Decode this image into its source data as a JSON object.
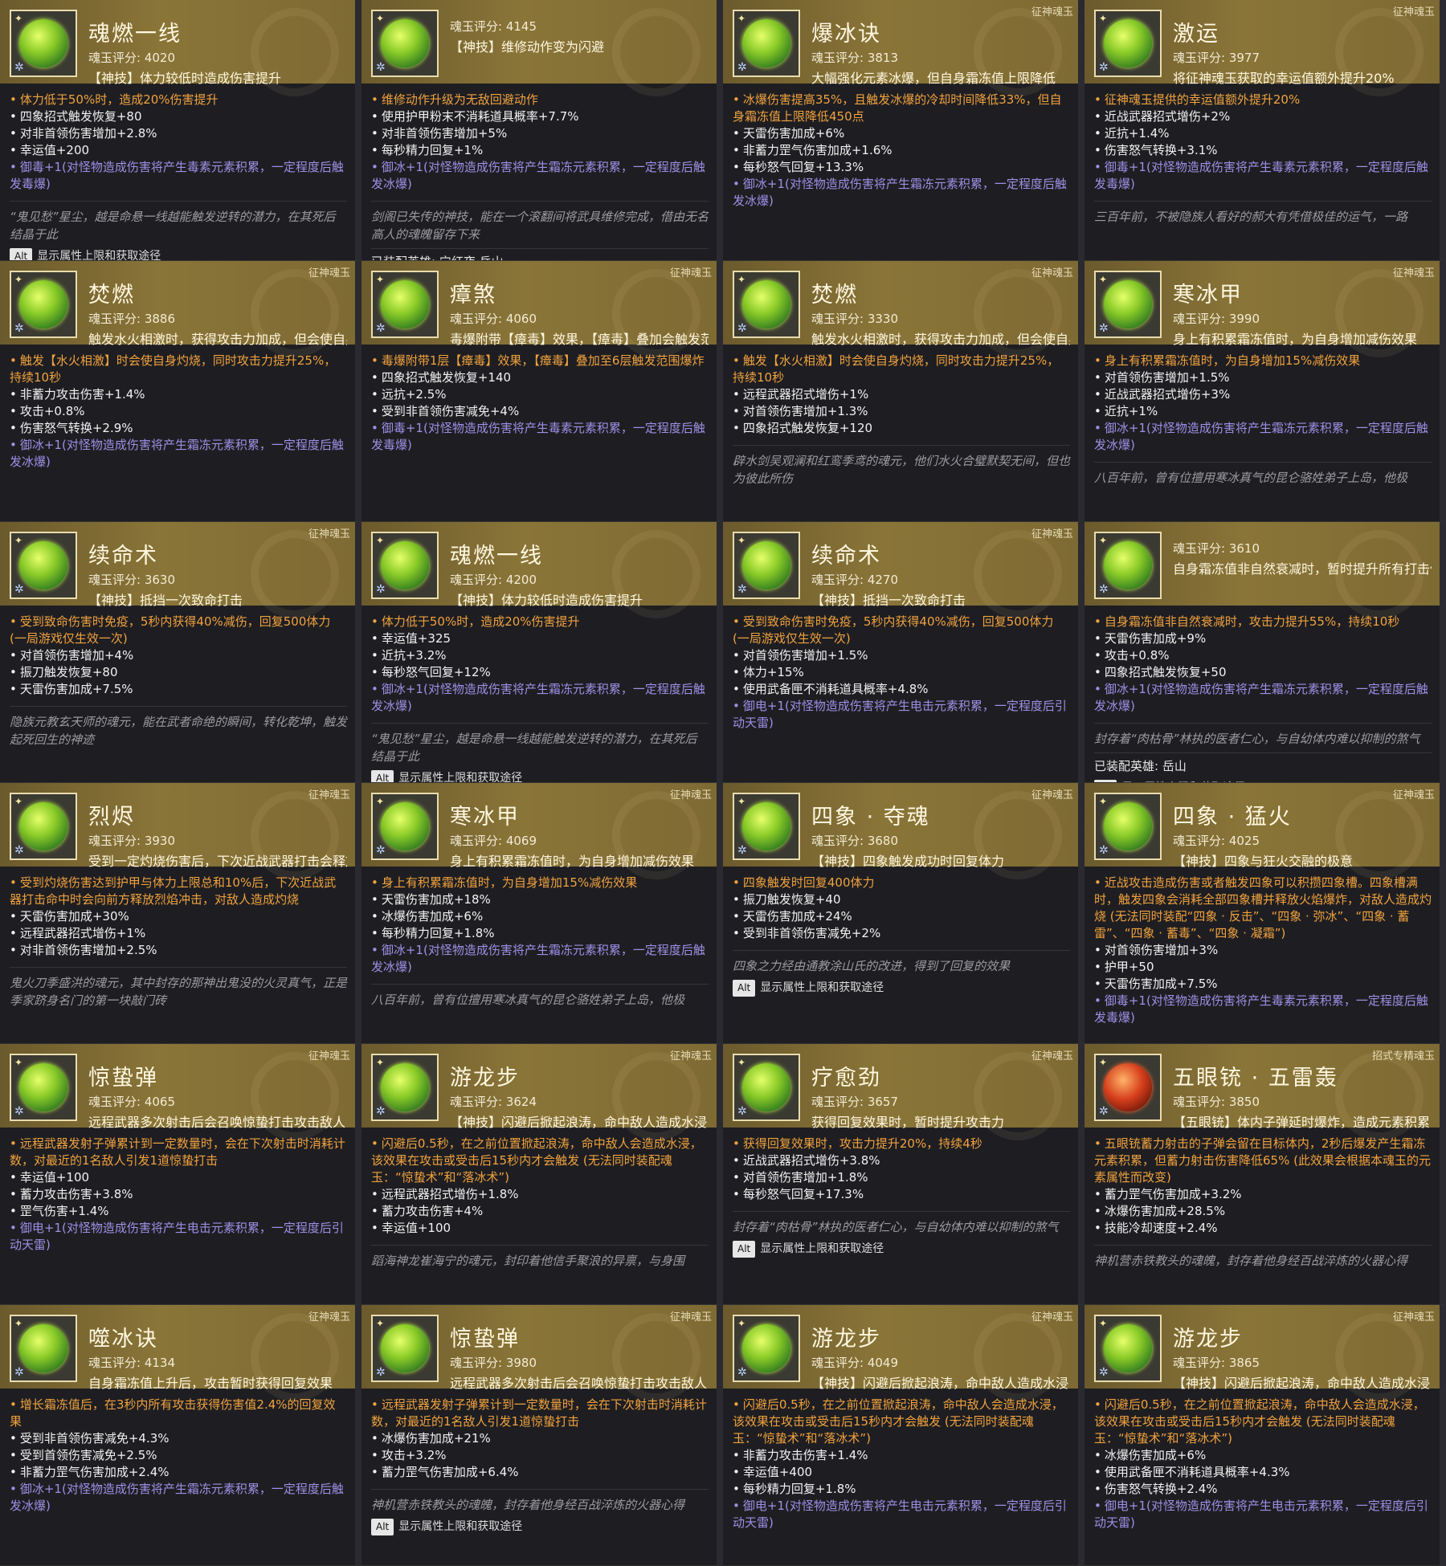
{
  "alt_key": "Alt",
  "alt_text": "显示属性上限和获取途径",
  "cards": [
    {
      "name": "魂燃一线",
      "type": "",
      "score": "魂玉评分: 4020",
      "desc": "【神技】体力较低时造成伤害提升",
      "glyph": "green-flame",
      "lines": [
        {
          "c": "orange",
          "t": "体力低于50%时，造成20%伤害提升"
        },
        {
          "c": "white",
          "t": "四象招式触发恢复+80"
        },
        {
          "c": "white",
          "t": "对非首领伤害增加+2.8%"
        },
        {
          "c": "white",
          "t": "幸运值+200"
        },
        {
          "c": "purple",
          "t": "御毒+1(对怪物造成伤害将产生毒素元素积累，一定程度后触发毒爆)"
        }
      ],
      "flavor": "“鬼见愁”星尘，越是命悬一线越能触发逆转的潜力，在其死后结晶于此",
      "equipped": "",
      "alt": true
    },
    {
      "name": "",
      "type": "",
      "score": "魂玉评分: 4145",
      "desc": "【神技】维修动作变为闪避",
      "glyph": "green-flame",
      "lines": [
        {
          "c": "orange",
          "t": "维修动作升级为无敌回避动作"
        },
        {
          "c": "white",
          "t": "使用护甲粉末不消耗道具概率+7.7%"
        },
        {
          "c": "white",
          "t": "对非首领伤害增加+5%"
        },
        {
          "c": "white",
          "t": "每秒精力回复+1%"
        },
        {
          "c": "purple",
          "t": "御冰+1(对怪物造成伤害将产生霜冻元素积累，一定程度后触发冰爆)"
        }
      ],
      "flavor": "剑阁已失传的神技，能在一个滚翻间将武具维修完成，借由无名高人的魂魄留存下来",
      "equipped": "已装配英雄: 宁红夜 岳山",
      "alt": true
    },
    {
      "name": "爆冰诀",
      "type": "征神魂玉",
      "score": "魂玉评分: 3813",
      "desc": "大幅强化元素冰爆，但自身霜冻值上限降低",
      "glyph": "green-flame",
      "lines": [
        {
          "c": "orange",
          "t": "冰爆伤害提高35%，且触发冰爆的冷却时间降低33%，但自身霜冻值上限降低450点"
        },
        {
          "c": "white",
          "t": "天雷伤害加成+6%"
        },
        {
          "c": "white",
          "t": "非蓄力罡气伤害加成+1.6%"
        },
        {
          "c": "white",
          "t": "每秒怒气回复+13.3%"
        },
        {
          "c": "purple",
          "t": "御冰+1(对怪物造成伤害将产生霜冻元素积累，一定程度后触发冰爆)"
        }
      ],
      "flavor": "",
      "equipped": "",
      "alt": false
    },
    {
      "name": "激运",
      "type": "征神魂玉",
      "score": "魂玉评分: 3977",
      "desc": "将征神魂玉获取的幸运值额外提升20%",
      "glyph": "green-flame",
      "lines": [
        {
          "c": "orange",
          "t": "征神魂玉提供的幸运值额外提升20%"
        },
        {
          "c": "white",
          "t": "近战武器招式增伤+2%"
        },
        {
          "c": "white",
          "t": "近抗+1.4%"
        },
        {
          "c": "white",
          "t": "伤害怒气转换+3.1%"
        },
        {
          "c": "purple",
          "t": "御毒+1(对怪物造成伤害将产生毒素元素积累，一定程度后触发毒爆)"
        }
      ],
      "flavor": "三百年前，不被隐族人看好的郝大有凭借极佳的运气，一路",
      "equipped": "",
      "alt": false
    },
    {
      "name": "焚燃",
      "type": "征神魂玉",
      "score": "魂玉评分: 3886",
      "desc": "触发水火相激时，获得攻击力加成，但会使自身灼烧",
      "glyph": "green-flame",
      "lines": [
        {
          "c": "orange",
          "t": "触发【水火相激】时会使自身灼烧，同时攻击力提升25%，持续10秒"
        },
        {
          "c": "white",
          "t": "非蓄力攻击伤害+1.4%"
        },
        {
          "c": "white",
          "t": "攻击+0.8%"
        },
        {
          "c": "white",
          "t": "伤害怒气转换+2.9%"
        },
        {
          "c": "purple",
          "t": "御冰+1(对怪物造成伤害将产生霜冻元素积累，一定程度后触发冰爆)"
        }
      ],
      "flavor": "",
      "equipped": "",
      "alt": false
    },
    {
      "name": "瘴煞",
      "type": "征神魂玉",
      "score": "魂玉评分: 4060",
      "desc": "毒爆附带【瘴毒】效果，【瘴毒】叠加会触发范围",
      "glyph": "green-flame",
      "lines": [
        {
          "c": "orange",
          "t": "毒爆附带1层【瘴毒】效果，【瘴毒】叠加至6层触发范围爆炸"
        },
        {
          "c": "white",
          "t": "四象招式触发恢复+140"
        },
        {
          "c": "white",
          "t": "远抗+2.5%"
        },
        {
          "c": "white",
          "t": "受到非首领伤害减免+4%"
        },
        {
          "c": "purple",
          "t": "御毒+1(对怪物造成伤害将产生毒素元素积累，一定程度后触发毒爆)"
        }
      ],
      "flavor": "",
      "equipped": "",
      "alt": false
    },
    {
      "name": "焚燃",
      "type": "征神魂玉",
      "score": "魂玉评分: 3330",
      "desc": "触发水火相激时，获得攻击力加成，但会使自身灼烧",
      "glyph": "green-flame",
      "lines": [
        {
          "c": "orange",
          "t": "触发【水火相激】时会使自身灼烧，同时攻击力提升25%，持续10秒"
        },
        {
          "c": "white",
          "t": "远程武器招式增伤+1%"
        },
        {
          "c": "white",
          "t": "对首领伤害增加+1.3%"
        },
        {
          "c": "white",
          "t": "四象招式触发恢复+120"
        }
      ],
      "flavor": "辟水剑吴观澜和红鸾季鸢的魂元，他们水火合璧默契无间，但也为彼此所伤",
      "equipped": "",
      "alt": false
    },
    {
      "name": "寒冰甲",
      "type": "征神魂玉",
      "score": "魂玉评分: 3990",
      "desc": "身上有积累霜冻值时，为自身增加减伤效果",
      "glyph": "green-flame",
      "lines": [
        {
          "c": "orange",
          "t": "身上有积累霜冻值时，为自身增加15%减伤效果"
        },
        {
          "c": "white",
          "t": "对首领伤害增加+1.5%"
        },
        {
          "c": "white",
          "t": "近战武器招式增伤+3%"
        },
        {
          "c": "white",
          "t": "近抗+1%"
        },
        {
          "c": "purple",
          "t": "御冰+1(对怪物造成伤害将产生霜冻元素积累，一定程度后触发冰爆)"
        }
      ],
      "flavor": "八百年前，曾有位擅用寒冰真气的昆仑骆姓弟子上岛，他极",
      "equipped": "",
      "alt": false
    },
    {
      "name": "续命术",
      "type": "征神魂玉",
      "score": "魂玉评分: 3630",
      "desc": "【神技】抵挡一次致命打击",
      "glyph": "green-flame",
      "lines": [
        {
          "c": "orange",
          "t": "受到致命伤害时免疫，5秒内获得40%减伤，回复500体力(一局游戏仅生效一次)"
        },
        {
          "c": "white",
          "t": "对首领伤害增加+4%"
        },
        {
          "c": "white",
          "t": "振刀触发恢复+80"
        },
        {
          "c": "white",
          "t": "天雷伤害加成+7.5%"
        }
      ],
      "flavor": "隐族元教玄天师的魂元，能在武者命绝的瞬间，转化乾坤，触发起死回生的神迹",
      "equipped": "",
      "alt": false
    },
    {
      "name": "魂燃一线",
      "type": "",
      "score": "魂玉评分: 4200",
      "desc": "【神技】体力较低时造成伤害提升",
      "glyph": "green-flame",
      "lines": [
        {
          "c": "orange",
          "t": "体力低于50%时，造成20%伤害提升"
        },
        {
          "c": "white",
          "t": "幸运值+325"
        },
        {
          "c": "white",
          "t": "近抗+3.2%"
        },
        {
          "c": "white",
          "t": "每秒怒气回复+12%"
        },
        {
          "c": "purple",
          "t": "御冰+1(对怪物造成伤害将产生霜冻元素积累，一定程度后触发冰爆)"
        }
      ],
      "flavor": "“鬼见愁”星尘，越是命悬一线越能触发逆转的潜力，在其死后结晶于此",
      "equipped": "",
      "alt": true
    },
    {
      "name": "续命术",
      "type": "征神魂玉",
      "score": "魂玉评分: 4270",
      "desc": "【神技】抵挡一次致命打击",
      "glyph": "green-flame",
      "lines": [
        {
          "c": "orange",
          "t": "受到致命伤害时免疫，5秒内获得40%减伤，回复500体力(一局游戏仅生效一次)"
        },
        {
          "c": "white",
          "t": "对首领伤害增加+1.5%"
        },
        {
          "c": "white",
          "t": "体力+15%"
        },
        {
          "c": "white",
          "t": "使用武备匣不消耗道具概率+4.8%"
        },
        {
          "c": "purple",
          "t": "御电+1(对怪物造成伤害将产生电击元素积累，一定程度后引动天雷)"
        }
      ],
      "flavor": "",
      "equipped": "",
      "alt": false
    },
    {
      "name": "",
      "type": "",
      "score": "魂玉评分: 3610",
      "desc": "自身霜冻值非自然衰减时，暂时提升所有打击伤害",
      "glyph": "green-leaf",
      "lines": [
        {
          "c": "orange",
          "t": "自身霜冻值非自然衰减时，攻击力提升55%，持续10秒"
        },
        {
          "c": "white",
          "t": "天雷伤害加成+9%"
        },
        {
          "c": "white",
          "t": "攻击+0.8%"
        },
        {
          "c": "white",
          "t": "四象招式触发恢复+50"
        },
        {
          "c": "purple",
          "t": "御冰+1(对怪物造成伤害将产生霜冻元素积累，一定程度后触发冰爆)"
        }
      ],
      "flavor": "封存着“肉枯骨”林执的医者仁心，与自幼体内难以抑制的煞气",
      "equipped": "已装配英雄: 岳山",
      "alt": true
    },
    {
      "name": "烈烬",
      "type": "征神魂玉",
      "score": "魂玉评分: 3930",
      "desc": "受到一定灼烧伤害后，下次近战武器打击会释放烈焰",
      "glyph": "green-flame",
      "lines": [
        {
          "c": "orange",
          "t": "受到灼烧伤害达到护甲与体力上限总和10%后，下次近战武器打击命中时会向前方释放烈焰冲击，对敌人造成灼烧"
        },
        {
          "c": "white",
          "t": "天雷伤害加成+30%"
        },
        {
          "c": "white",
          "t": "远程武器招式增伤+1%"
        },
        {
          "c": "white",
          "t": "对非首领伤害增加+2.5%"
        }
      ],
      "flavor": "鬼火刀季盛洪的魂元，其中封存的那神出鬼没的火灵真气，正是季家跻身名门的第一块敲门砖",
      "equipped": "",
      "alt": false
    },
    {
      "name": "寒冰甲",
      "type": "征神魂玉",
      "score": "魂玉评分: 4069",
      "desc": "身上有积累霜冻值时，为自身增加减伤效果",
      "glyph": "green-leaf",
      "lines": [
        {
          "c": "orange",
          "t": "身上有积累霜冻值时，为自身增加15%减伤效果"
        },
        {
          "c": "white",
          "t": "天雷伤害加成+18%"
        },
        {
          "c": "white",
          "t": "冰爆伤害加成+6%"
        },
        {
          "c": "white",
          "t": "每秒精力回复+1.8%"
        },
        {
          "c": "purple",
          "t": "御冰+1(对怪物造成伤害将产生霜冻元素积累，一定程度后触发冰爆)"
        }
      ],
      "flavor": "八百年前，曾有位擅用寒冰真气的昆仑骆姓弟子上岛，他极",
      "equipped": "",
      "alt": false
    },
    {
      "name": "四象 · 夺魂",
      "type": "征神魂玉",
      "score": "魂玉评分: 3680",
      "desc": "【神技】四象触发成功时回复体力",
      "glyph": "green-cross",
      "lines": [
        {
          "c": "orange",
          "t": "四象触发时回复400体力"
        },
        {
          "c": "white",
          "t": "振刀触发恢复+40"
        },
        {
          "c": "white",
          "t": "天雷伤害加成+24%"
        },
        {
          "c": "white",
          "t": "受到非首领伤害减免+2%"
        }
      ],
      "flavor": "四象之力经由通教涂山氏的改进，得到了回复的效果",
      "equipped": "",
      "alt": true
    },
    {
      "name": "四象 · 猛火",
      "type": "征神魂玉",
      "score": "魂玉评分: 4025",
      "desc": "【神技】四象与狂火交融的极意",
      "glyph": "green-cross",
      "lines": [
        {
          "c": "orange",
          "t": "近战攻击造成伤害或者触发四象可以积攒四象槽。四象槽满时，触发四象会消耗全部四象槽并释放火焰爆炸，对敌人造成灼烧 (无法同时装配“四象 · 反击”、“四象 · 弥冰”、“四象 · 蓄雷”、“四象 · 蓄毒”、“四象 · 凝霜”)"
        },
        {
          "c": "white",
          "t": "对首领伤害增加+3%"
        },
        {
          "c": "white",
          "t": "护甲+50"
        },
        {
          "c": "white",
          "t": "天雷伤害加成+7.5%"
        },
        {
          "c": "purple",
          "t": "御毒+1(对怪物造成伤害将产生毒素元素积累，一定程度后触发毒爆)"
        }
      ],
      "flavor": "",
      "equipped": "",
      "alt": false
    },
    {
      "name": "惊蛰弹",
      "type": "征神魂玉",
      "score": "魂玉评分: 4065",
      "desc": "远程武器多次射击后会召唤惊蛰打击攻击敌人",
      "glyph": "green-leaf",
      "lines": [
        {
          "c": "orange",
          "t": "远程武器发射子弹累计到一定数量时，会在下次射击时消耗计数，对最近的1名敌人引发1道惊蛰打击"
        },
        {
          "c": "white",
          "t": "幸运值+100"
        },
        {
          "c": "white",
          "t": "蓄力攻击伤害+3.8%"
        },
        {
          "c": "white",
          "t": "罡气伤害+1.4%"
        },
        {
          "c": "purple",
          "t": "御电+1(对怪物造成伤害将产生电击元素积累，一定程度后引动天雷)"
        }
      ],
      "flavor": "",
      "equipped": "",
      "alt": false
    },
    {
      "name": "游龙步",
      "type": "征神魂玉",
      "score": "魂玉评分: 3624",
      "desc": "【神技】闪避后掀起浪涛，命中敌人造成水浸",
      "glyph": "green-leaf",
      "lines": [
        {
          "c": "orange",
          "t": "闪避后0.5秒，在之前位置掀起浪涛，命中敌人会造成水浸，该效果在攻击或受击后15秒内才会触发 (无法同时装配魂玉：“惊蛰术”和“落冰术”)"
        },
        {
          "c": "white",
          "t": "远程武器招式增伤+1.8%"
        },
        {
          "c": "white",
          "t": "蓄力攻击伤害+4%"
        },
        {
          "c": "white",
          "t": "幸运值+100"
        }
      ],
      "flavor": "蹈海神龙崔海宁的魂元，封印着他信手聚浪的异禀，与身围",
      "equipped": "",
      "alt": false
    },
    {
      "name": "疗愈劲",
      "type": "征神魂玉",
      "score": "魂玉评分: 3657",
      "desc": "获得回复效果时，暂时提升攻击力",
      "glyph": "green-leaf",
      "lines": [
        {
          "c": "orange",
          "t": "获得回复效果时，攻击力提升20%，持续4秒"
        },
        {
          "c": "white",
          "t": "近战武器招式增伤+3.8%"
        },
        {
          "c": "white",
          "t": "对首领伤害增加+1.8%"
        },
        {
          "c": "white",
          "t": "每秒怒气回复+17.3%"
        }
      ],
      "flavor": "封存着“肉枯骨”林执的医者仁心，与自幼体内难以抑制的煞气",
      "equipped": "",
      "alt": true
    },
    {
      "name": "五眼铳 · 五雷轰",
      "type": "招式专精魂玉",
      "score": "魂玉评分: 3850",
      "desc": "【五眼铳】体内子弹延时爆炸，造成元素积累",
      "glyph": "red",
      "lines": [
        {
          "c": "orange",
          "t": "五眼铳蓄力射击的子弹会留在目标体内，2秒后爆发产生霜冻元素积累，但蓄力射击伤害降低65% (此效果会根据本魂玉的元素属性而改变)"
        },
        {
          "c": "white",
          "t": "蓄力罡气伤害加成+3.2%"
        },
        {
          "c": "white",
          "t": "冰爆伤害加成+28.5%"
        },
        {
          "c": "white",
          "t": "技能冷却速度+2.4%"
        }
      ],
      "flavor": "神机营赤铁教头的魂魄，封存着他身经百战淬炼的火器心得",
      "equipped": "",
      "alt": false
    },
    {
      "name": "噬冰诀",
      "type": "征神魂玉",
      "score": "魂玉评分: 4134",
      "desc": "自身霜冻值上升后，攻击暂时获得回复效果",
      "glyph": "green-leaf",
      "lines": [
        {
          "c": "orange",
          "t": "增长霜冻值后，在3秒内所有攻击获得伤害值2.4%的回复效果"
        },
        {
          "c": "white",
          "t": "受到非首领伤害减免+4.3%"
        },
        {
          "c": "white",
          "t": "受到首领伤害减免+2.5%"
        },
        {
          "c": "white",
          "t": "非蓄力罡气伤害加成+2.4%"
        },
        {
          "c": "purple",
          "t": "御冰+1(对怪物造成伤害将产生霜冻元素积累，一定程度后触发冰爆)"
        }
      ],
      "flavor": "",
      "equipped": "",
      "alt": false
    },
    {
      "name": "惊蛰弹",
      "type": "征神魂玉",
      "score": "魂玉评分: 3980",
      "desc": "远程武器多次射击后会召唤惊蛰打击攻击敌人",
      "glyph": "green-leaf",
      "lines": [
        {
          "c": "orange",
          "t": "远程武器发射子弹累计到一定数量时，会在下次射击时消耗计数，对最近的1名敌人引发1道惊蛰打击"
        },
        {
          "c": "white",
          "t": "冰爆伤害加成+21%"
        },
        {
          "c": "white",
          "t": "攻击+3.2%"
        },
        {
          "c": "white",
          "t": "蓄力罡气伤害加成+6.4%"
        }
      ],
      "flavor": "神机营赤铁教头的魂魄，封存着他身经百战淬炼的火器心得",
      "equipped": "",
      "alt": true
    },
    {
      "name": "游龙步",
      "type": "征神魂玉",
      "score": "魂玉评分: 4049",
      "desc": "【神技】闪避后掀起浪涛，命中敌人造成水浸",
      "glyph": "green-leaf",
      "lines": [
        {
          "c": "orange",
          "t": "闪避后0.5秒，在之前位置掀起浪涛，命中敌人会造成水浸，该效果在攻击或受击后15秒内才会触发 (无法同时装配魂玉：“惊蛰术”和“落冰术”)"
        },
        {
          "c": "white",
          "t": "非蓄力攻击伤害+1.4%"
        },
        {
          "c": "white",
          "t": "幸运值+400"
        },
        {
          "c": "white",
          "t": "每秒精力回复+1.8%"
        },
        {
          "c": "purple",
          "t": "御电+1(对怪物造成伤害将产生电击元素积累，一定程度后引动天雷)"
        }
      ],
      "flavor": "",
      "equipped": "",
      "alt": false
    },
    {
      "name": "游龙步",
      "type": "征神魂玉",
      "score": "魂玉评分: 3865",
      "desc": "【神技】闪避后掀起浪涛，命中敌人造成水浸",
      "glyph": "green-leaf",
      "lines": [
        {
          "c": "orange",
          "t": "闪避后0.5秒，在之前位置掀起浪涛，命中敌人会造成水浸，该效果在攻击或受击后15秒内才会触发 (无法同时装配魂玉：“惊蛰术”和“落冰术”)"
        },
        {
          "c": "white",
          "t": "冰爆伤害加成+6%"
        },
        {
          "c": "white",
          "t": "使用武备匣不消耗道具概率+4.3%"
        },
        {
          "c": "white",
          "t": "伤害怒气转换+2.4%"
        },
        {
          "c": "purple",
          "t": "御电+1(对怪物造成伤害将产生电击元素积累，一定程度后引动天雷)"
        }
      ],
      "flavor": "",
      "equipped": "",
      "alt": false
    }
  ]
}
